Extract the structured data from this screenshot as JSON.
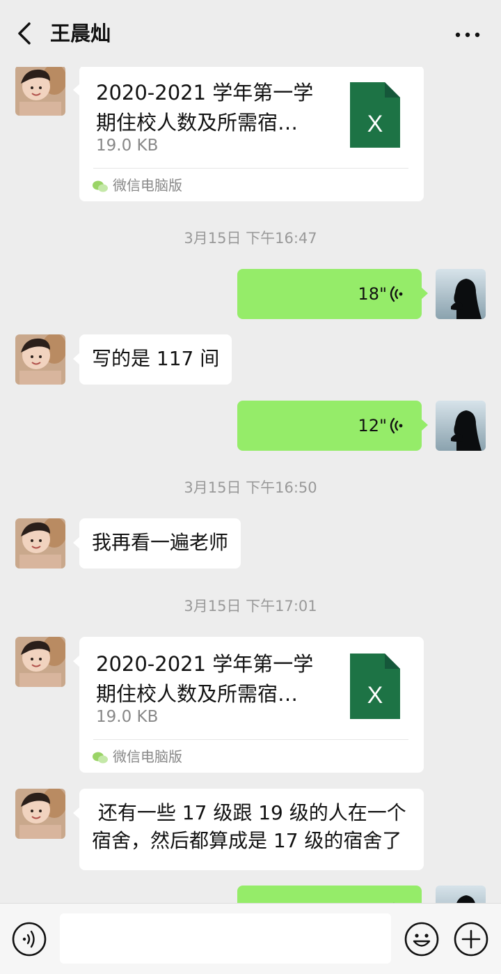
{
  "header": {
    "title": "王晨灿",
    "back_icon": "chevron-left-icon",
    "more_icon": "more-dots-icon"
  },
  "colors": {
    "background": "#ededed",
    "bubble_green": "#95ec69",
    "excel_green": "#1d7345",
    "timestamp": "#999999"
  },
  "messages": [
    {
      "kind": "file",
      "name_line1": "2020-2021 学年第一学",
      "name_line2": "期住校人数及所需宿…",
      "size": "19.0 KB",
      "source": "微信电脑版",
      "icon": "excel-icon",
      "icon_letter": "X"
    },
    {
      "kind": "timestamp",
      "text": "3月15日 下午16:47"
    },
    {
      "kind": "voice",
      "duration": "18\""
    },
    {
      "kind": "text",
      "text": "写的是 117 间"
    },
    {
      "kind": "voice",
      "duration": "12\""
    },
    {
      "kind": "timestamp",
      "text": "3月15日 下午16:50"
    },
    {
      "kind": "text",
      "text": "我再看一遍老师"
    },
    {
      "kind": "timestamp",
      "text": "3月15日 下午17:01"
    },
    {
      "kind": "file",
      "name_line1": "2020-2021 学年第一学",
      "name_line2": "期住校人数及所需宿…",
      "size": "19.0 KB",
      "source": "微信电脑版",
      "icon": "excel-icon",
      "icon_letter": "X"
    },
    {
      "kind": "text",
      "text_line1": " 还有一些 17 级跟 19 级的人在一个",
      "text_line2": "宿舍，然后都算成是 17 级的宿舍了"
    }
  ],
  "input_bar": {
    "voice_icon": "voice-mode-icon",
    "emoji_icon": "emoji-icon",
    "plus_icon": "plus-icon"
  }
}
